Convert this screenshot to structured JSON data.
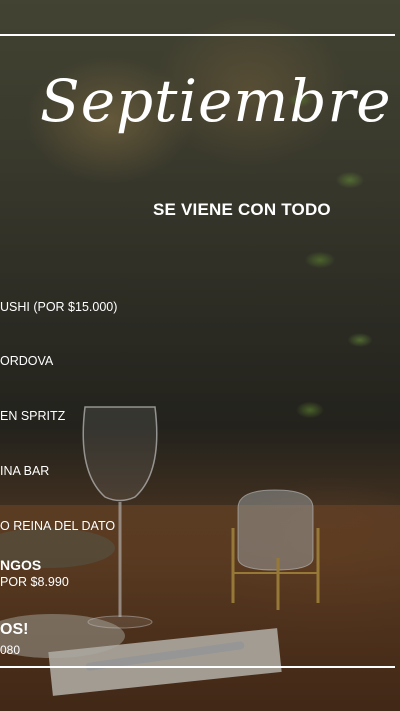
{
  "header": {
    "title": "Septiembre",
    "subtitle": "SE VIENE CON TODO"
  },
  "items": [
    "USHI (POR $15.000)",
    "ORDOVA",
    "EN SPRITZ",
    "INA BAR",
    "O REINA DEL DATO",
    "NGOS",
    "POR $8.990",
    "OS!",
    "080"
  ],
  "colors": {
    "text": "#ffffff",
    "rule": "#ffffff"
  }
}
